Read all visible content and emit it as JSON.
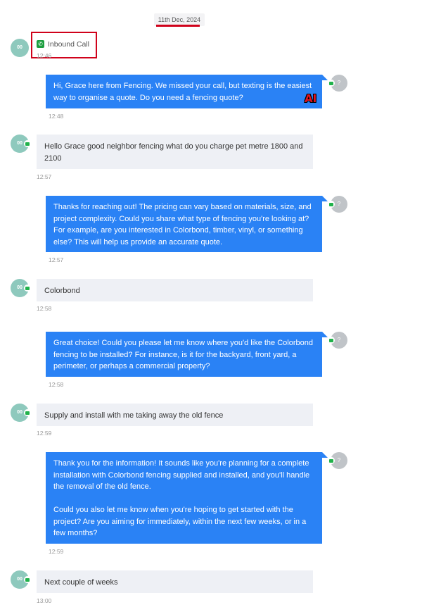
{
  "date_separator": "11th Dec, 2024",
  "contact_avatar_initials": "00",
  "agent_avatar_initials": "?",
  "ai_badge": "AI",
  "call_event": {
    "label": "Inbound Call",
    "time": "12:46",
    "icon": "phone-icon"
  },
  "messages": [
    {
      "direction": "outbound",
      "text": "Hi, Grace here from                      Fencing. We missed your call, but texting is the easiest way to organise a quote. Do you need a fencing quote?",
      "time": "12:48"
    },
    {
      "direction": "inbound",
      "text": "Hello Grace good neighbor fencing what do you charge pet metre 1800 and 2100",
      "time": "12:57"
    },
    {
      "direction": "outbound",
      "text": "Thanks for reaching out! The pricing can vary based on materials, size, and project complexity. Could you share what type of fencing you're looking at? For example, are you interested in Colorbond, timber, vinyl, or something else? This will help us provide an accurate quote.",
      "time": "12:57"
    },
    {
      "direction": "inbound",
      "text": "Colorbond",
      "time": "12:58"
    },
    {
      "direction": "outbound",
      "text": "Great choice! Could you please let me know where you'd like the Colorbond fencing to be installed? For instance, is it for the backyard, front yard, a perimeter, or perhaps a commercial property?",
      "time": "12:58"
    },
    {
      "direction": "inbound",
      "text": "Supply and install with me taking away the old fence",
      "time": "12:59"
    },
    {
      "direction": "outbound",
      "text": "Thank you for the information! It sounds like you're planning for a complete installation with Colorbond fencing supplied and installed, and you'll handle the removal of the old fence.",
      "text2": "Could you also let me know when you're hoping to get started with the project? Are you aiming for immediately, within the next few weeks, or in a few months?",
      "time": "12:59"
    },
    {
      "direction": "inbound",
      "text": "Next couple of weeks",
      "time": "13:00"
    }
  ],
  "colors": {
    "outbound_bubble": "#2a82f5",
    "inbound_bubble": "#eef0f5",
    "highlight": "#d0021b",
    "sms_badge": "#21b24b"
  }
}
